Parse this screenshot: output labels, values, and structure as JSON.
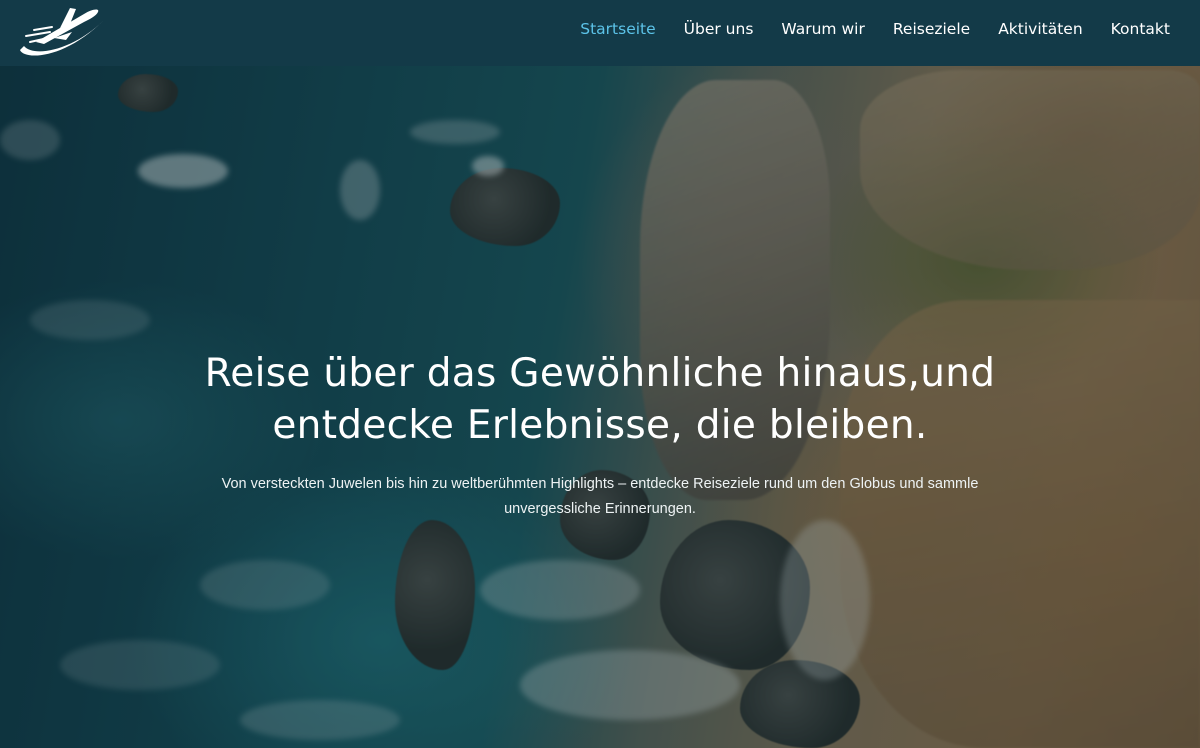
{
  "nav": {
    "items": [
      {
        "label": "Startseite",
        "active": true
      },
      {
        "label": "Über uns",
        "active": false
      },
      {
        "label": "Warum wir",
        "active": false
      },
      {
        "label": "Reiseziele",
        "active": false
      },
      {
        "label": "Aktivitäten",
        "active": false
      },
      {
        "label": "Kontakt",
        "active": false
      }
    ],
    "active_color": "#5cc3e8",
    "background": "#133a48"
  },
  "logo": {
    "icon": "airplane-swoosh-icon"
  },
  "hero": {
    "title_line1": "Reise über das Gewöhnliche hinaus,und",
    "title_line2": "entdecke Erlebnisse, die bleiben.",
    "subtitle": "Von versteckten Juwelen bis hin zu weltberühmten Highlights – entdecke Reiseziele rund um den Globus und sammle unvergessliche Erinnerungen.",
    "background_image": "aerial-coastline-cliffs-ocean"
  }
}
